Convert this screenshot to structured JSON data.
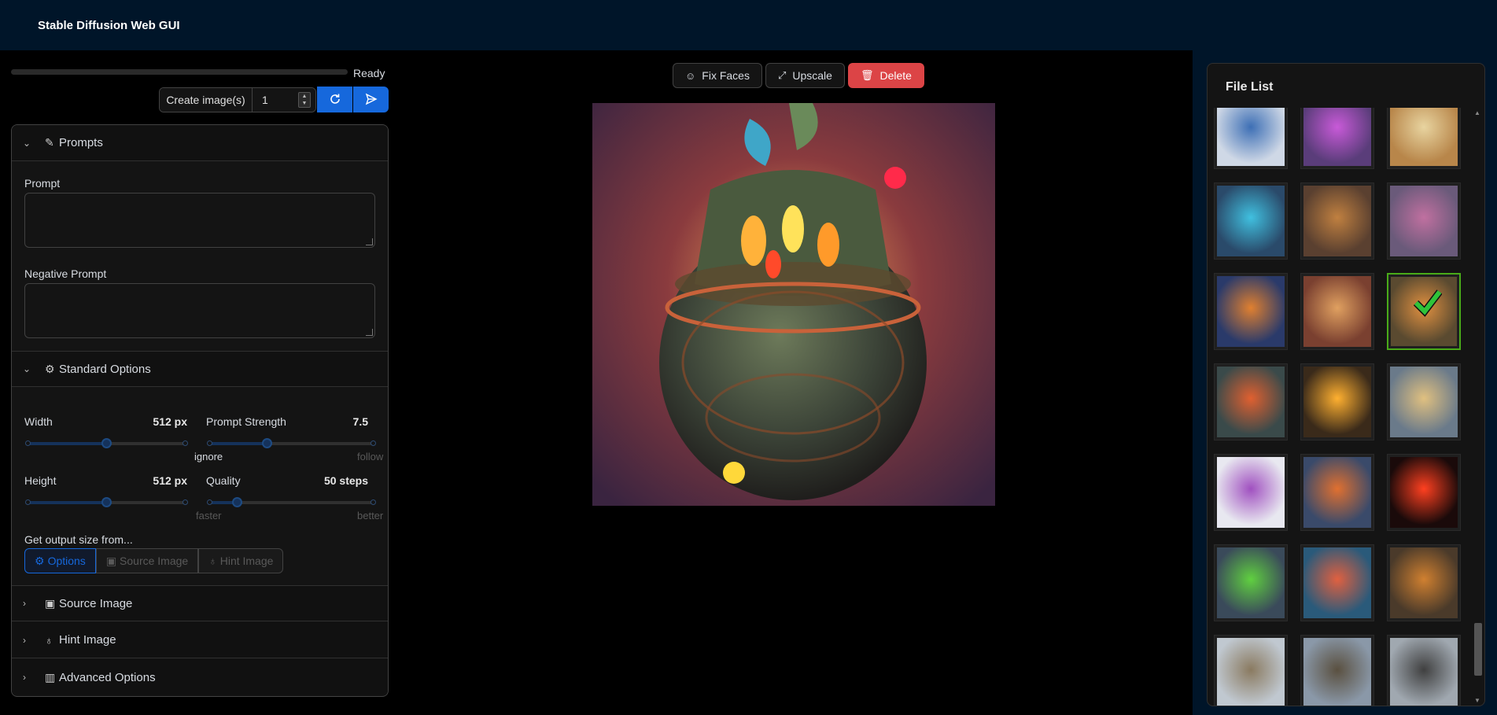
{
  "app": {
    "title": "Stable Diffusion Web GUI"
  },
  "generate": {
    "status": "Ready",
    "progress": 0,
    "create_label": "Create image(s)",
    "count": "1"
  },
  "sections": {
    "prompts": {
      "title": "Prompts",
      "prompt_label": "Prompt",
      "prompt_value": "",
      "negative_label": "Negative Prompt",
      "negative_value": ""
    },
    "standard": {
      "title": "Standard Options",
      "width": {
        "label": "Width",
        "value": "512 px",
        "level": 0.5
      },
      "height": {
        "label": "Height",
        "value": "512 px",
        "level": 0.5
      },
      "prompt_strength": {
        "label": "Prompt Strength",
        "value": "7.5",
        "level": 0.35,
        "min_mark": "ignore",
        "max_mark": "follow"
      },
      "quality": {
        "label": "Quality",
        "value": "50 steps",
        "level": 0.17,
        "min_mark": "faster",
        "max_mark": "better"
      },
      "output_size_label": "Get output size from...",
      "output_size_options": [
        "Options",
        "Source Image",
        "Hint Image"
      ],
      "output_size_selected": "Options"
    },
    "source_image": {
      "title": "Source Image"
    },
    "hint_image": {
      "title": "Hint Image"
    },
    "advanced": {
      "title": "Advanced Options"
    }
  },
  "actions": {
    "fix_faces": "Fix Faces",
    "upscale": "Upscale",
    "delete": "Delete"
  },
  "file_list": {
    "title": "File List",
    "selected_index": 8,
    "thumb_count": 21
  },
  "colors": {
    "header_bg": "#001529",
    "primary": "#1668dc",
    "danger": "#dc4446",
    "selected_border": "#49aa19"
  }
}
